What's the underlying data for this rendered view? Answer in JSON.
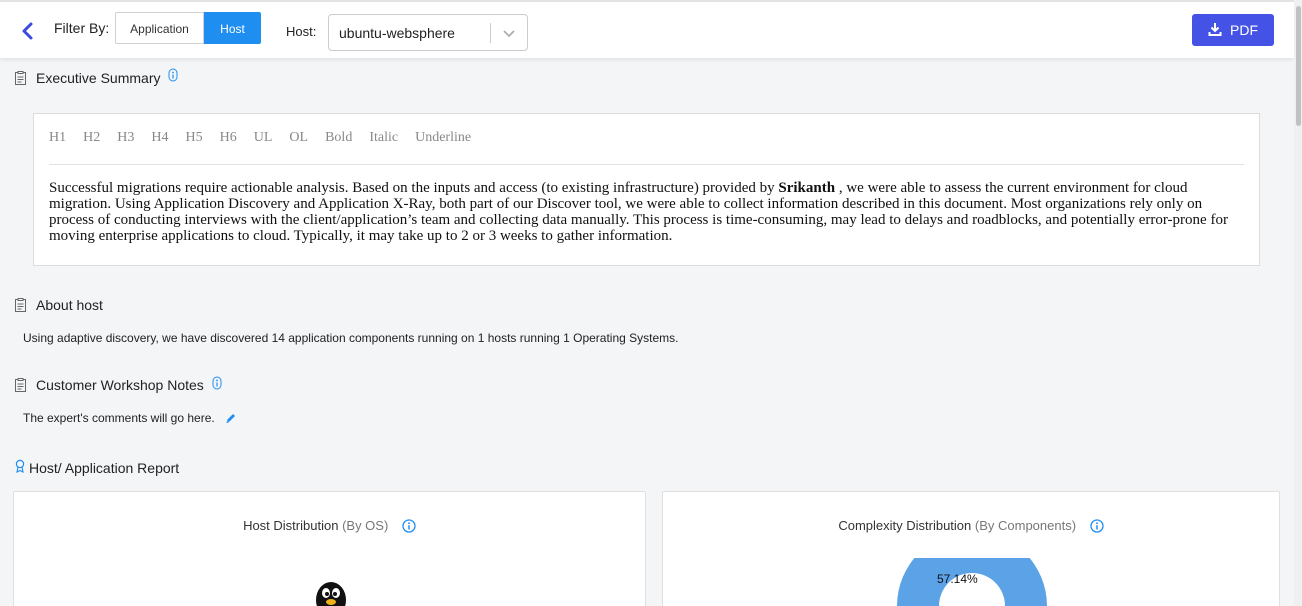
{
  "header": {
    "filter_label": "Filter By:",
    "filter_options": [
      "Application",
      "Host"
    ],
    "active_filter": "Host",
    "host_label": "Host:",
    "host_value": "ubuntu-websphere",
    "pdf_label": "PDF"
  },
  "executive_summary": {
    "title": "Executive Summary",
    "toolbar": [
      "H1",
      "H2",
      "H3",
      "H4",
      "H5",
      "H6",
      "UL",
      "OL",
      "Bold",
      "Italic",
      "Underline"
    ],
    "body_before": "Successful migrations require actionable analysis. Based on the inputs and access (to existing infrastructure) provided by ",
    "body_bold": "Srikanth",
    "body_after": " , we were able to assess the current environment for cloud migration. Using Application Discovery and Application X-Ray, both part of our Discover tool, we were able to collect information described in this document.     Most organizations rely only on process of conducting interviews with the client/application’s team and collecting data manually. This process is time-consuming, may lead to delays and roadblocks, and potentially error-prone for moving enterprise applications to cloud. Typically, it may take up to 2 or 3 weeks to gather information."
  },
  "about_host": {
    "title": "About host",
    "text": "Using adaptive discovery, we have discovered 14 application components running on 1 hosts running 1 Operating Systems."
  },
  "workshop_notes": {
    "title": "Customer Workshop Notes",
    "text": "The expert's comments will go here."
  },
  "report": {
    "title": "Host/ Application Report"
  },
  "cards": [
    {
      "title": "Host Distribution",
      "subtitle": "(By OS)"
    },
    {
      "title": "Complexity Distribution",
      "subtitle": "(By Components)",
      "percent_label": "57.14%"
    }
  ],
  "colors": {
    "accent": "#1f8ef1",
    "pdf": "#4453e6",
    "donut": "#5ba3e6"
  }
}
